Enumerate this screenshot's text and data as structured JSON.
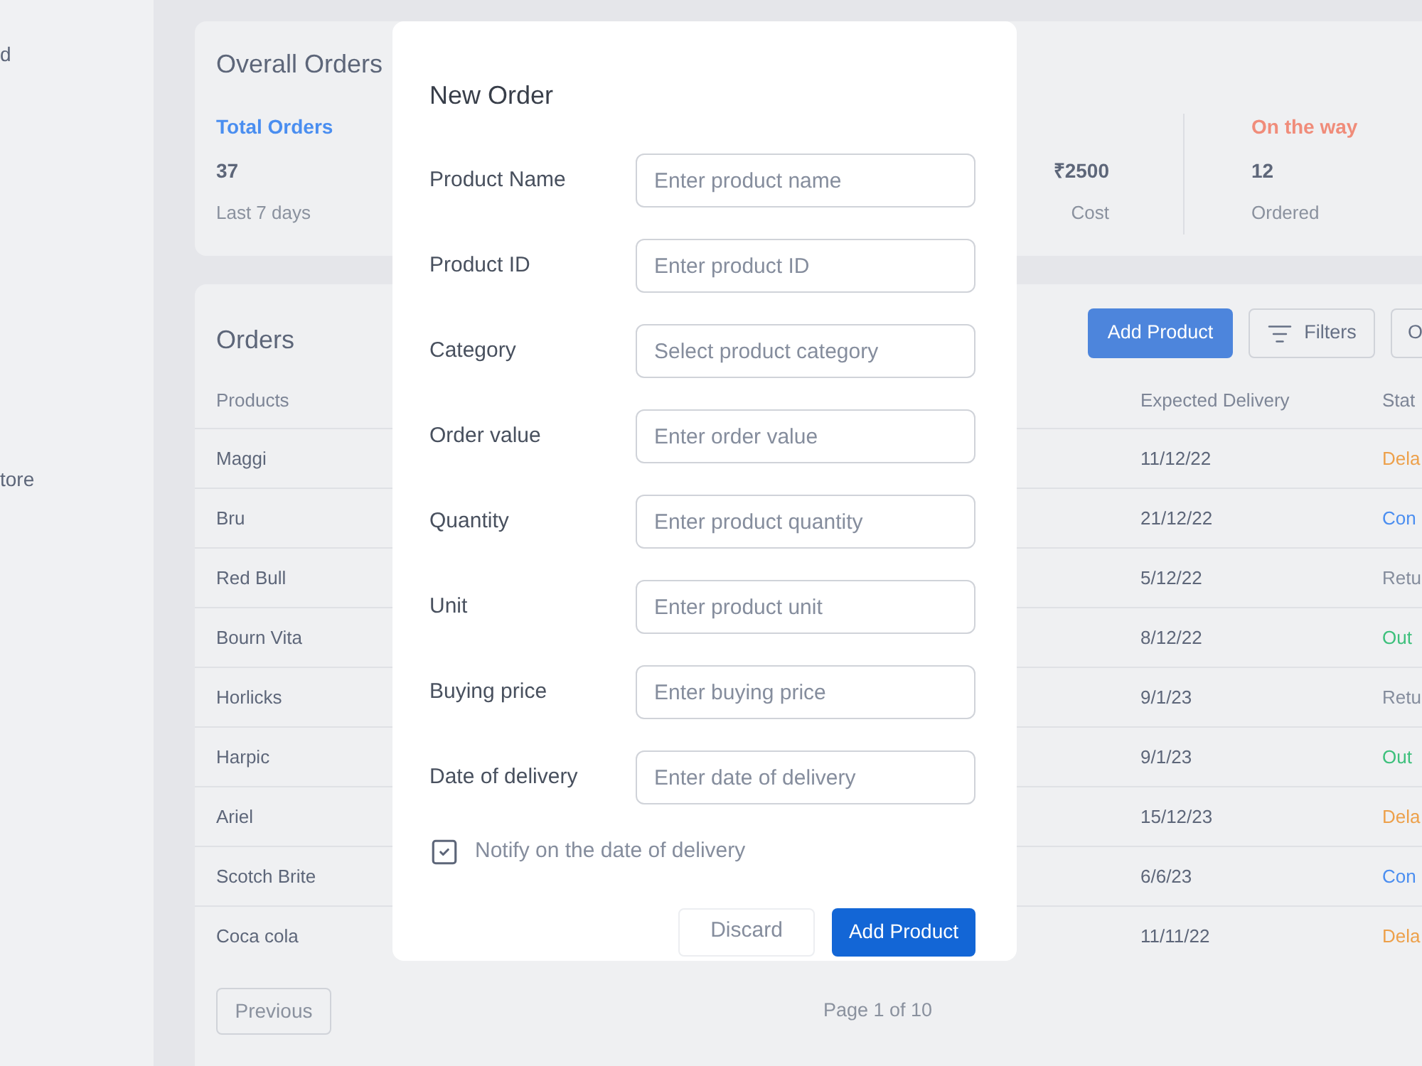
{
  "sidebar": {
    "items": [
      {
        "label": "d"
      },
      {
        "label": "tore"
      }
    ]
  },
  "overall_orders": {
    "title": "Overall Orders",
    "total_orders": {
      "heading": "Total Orders",
      "value": "37",
      "caption": "Last 7 days"
    },
    "cost_stat": {
      "value": "₹2500",
      "caption": "Cost"
    },
    "on_the_way": {
      "heading": "On the way",
      "value": "12",
      "caption": "Ordered"
    }
  },
  "orders": {
    "title": "Orders",
    "buttons": [
      {
        "label": "Add Product",
        "kind": "primary"
      },
      {
        "label": "Filters",
        "kind": "filter"
      },
      {
        "label": "O",
        "kind": "cut"
      }
    ],
    "columns": [
      "Products",
      "Expected Delivery",
      "Stat"
    ],
    "rows": [
      {
        "product": "Maggi",
        "expected_delivery": "11/12/22",
        "status": "Dela",
        "color": "#eda04a"
      },
      {
        "product": "Bru",
        "expected_delivery": "21/12/22",
        "status": "Con",
        "color": "#4b8ef0"
      },
      {
        "product": "Red Bull",
        "expected_delivery": "5/12/22",
        "status": "Retu",
        "color": "#858d9d"
      },
      {
        "product": "Bourn Vita",
        "expected_delivery": "8/12/22",
        "status": "Out",
        "color": "#3dc07c"
      },
      {
        "product": "Horlicks",
        "expected_delivery": "9/1/23",
        "status": "Retu",
        "color": "#858d9d"
      },
      {
        "product": "Harpic",
        "expected_delivery": "9/1/23",
        "status": "Out",
        "color": "#3dc07c"
      },
      {
        "product": "Ariel",
        "expected_delivery": "15/12/23",
        "status": "Dela",
        "color": "#eda04a"
      },
      {
        "product": "Scotch Brite",
        "expected_delivery": "6/6/23",
        "status": "Con",
        "color": "#4b8ef0"
      },
      {
        "product": "Coca cola",
        "expected_delivery": "11/11/22",
        "status": "Dela",
        "color": "#eda04a"
      }
    ],
    "previous": "Previous",
    "page": "Page 1 of 10"
  },
  "modal": {
    "title": "New Order",
    "fields": [
      {
        "label": "Product Name",
        "placeholder": "Enter product name"
      },
      {
        "label": "Product ID",
        "placeholder": "Enter product ID"
      },
      {
        "label": "Category",
        "placeholder": "Select product category"
      },
      {
        "label": "Order value",
        "placeholder": "Enter order value"
      },
      {
        "label": "Quantity",
        "placeholder": "Enter product quantity"
      },
      {
        "label": "Unit",
        "placeholder": "Enter product unit"
      },
      {
        "label": "Buying price",
        "placeholder": "Enter buying price"
      },
      {
        "label": "Date of delivery",
        "placeholder": "Enter date of delivery"
      }
    ],
    "notify": {
      "label": "Notify on the date of delivery",
      "checked": true
    },
    "buttons": [
      {
        "label": "Discard",
        "kind": "secondary"
      },
      {
        "label": "Add Product",
        "kind": "primary"
      }
    ]
  }
}
